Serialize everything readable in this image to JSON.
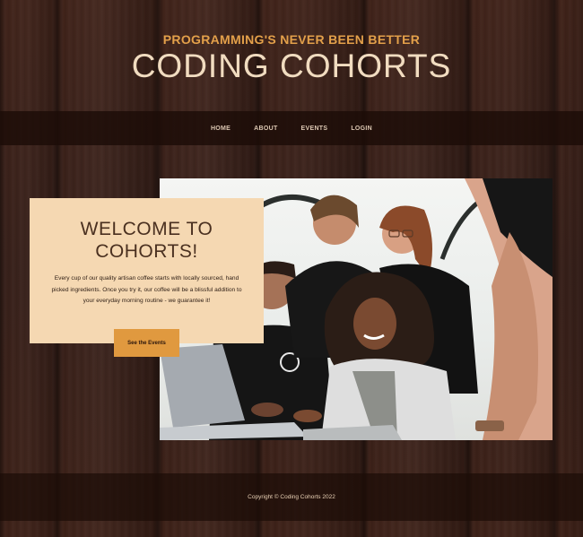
{
  "header": {
    "tagline": "PROGRAMMING'S NEVER BEEN BETTER",
    "title": "CODING COHORTS"
  },
  "nav": {
    "items": [
      "HOME",
      "ABOUT",
      "EVENTS",
      "LOGIN"
    ]
  },
  "welcome": {
    "title_line1": "WELCOME TO",
    "title_line2": "COHORTS!",
    "text": "Every cup of our quality artisan coffee starts with locally sourced, hand picked ingredients. Once you try it, our coffee will be a blissful addition to your everyday morning routine - we guarantee it!",
    "button_label": "See the Events"
  },
  "footer": {
    "copyright": "Copyright © Coding Cohorts 2022"
  },
  "colors": {
    "accent": "#e0993f",
    "card": "#f5d8b2",
    "title": "#f1dcc0",
    "background": "#3b2015"
  }
}
